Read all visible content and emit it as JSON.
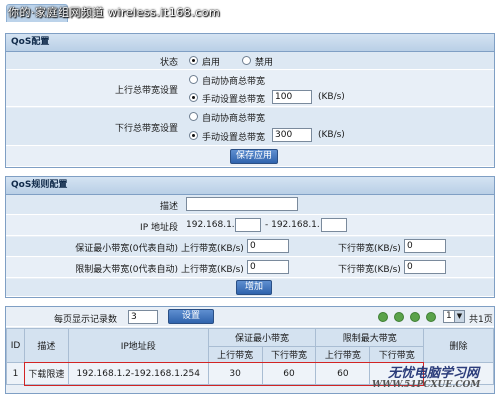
{
  "header": {
    "watermark": "你的·家庭组网频道 wireless.it168.com"
  },
  "qos_config": {
    "title": "QoS配置",
    "status": {
      "label": "状态",
      "options": [
        "启用",
        "禁用"
      ],
      "selected": "启用"
    },
    "upload": {
      "label": "上行总带宽设置",
      "auto_option": "自动协商总带宽",
      "manual_option": "手动设置总带宽",
      "selected": "手动设置总带宽",
      "value": "100",
      "unit": "(KB/s)"
    },
    "download": {
      "label": "下行总带宽设置",
      "auto_option": "自动协商总带宽",
      "manual_option": "手动设置总带宽",
      "selected": "手动设置总带宽",
      "value": "300",
      "unit": "(KB/s)"
    },
    "save_button": "保存应用"
  },
  "qos_rules": {
    "title": "QoS规则配置",
    "description_label": "描述",
    "description_value": "",
    "ip_label": "IP 地址段",
    "ip_prefix_start": "192.168.1.",
    "ip_separator": "- 192.168.1.",
    "ip_start_value": "",
    "ip_end_value": "",
    "min_bw_label": "保证最小带宽(0代表自动)",
    "max_bw_label": "限制最大带宽(0代表自动)",
    "up_kb_label": "上行带宽(KB/s)",
    "down_kb_label": "下行带宽(KB/s)",
    "min_up_value": "0",
    "min_down_value": "0",
    "max_up_value": "0",
    "max_down_value": "0",
    "add_button": "增加"
  },
  "list": {
    "per_page_label": "每页显示记录数",
    "per_page_value": "3",
    "set_button": "设置",
    "page_select": "1",
    "total_pages": "共1页",
    "columns": {
      "id": "ID",
      "desc": "描述",
      "ip": "IP地址段",
      "min_group": "保证最小带宽",
      "max_group": "限制最大带宽",
      "up": "上行带宽",
      "down": "下行带宽",
      "delete": "删除"
    },
    "rows": [
      {
        "id": "1",
        "desc": "下载限速",
        "ip": "192.168.1.2-192.168.1.254",
        "min_up": "30",
        "min_down": "60",
        "max_up": "60",
        "max_down": ""
      }
    ]
  },
  "footer_watermark": {
    "line1": "无忧电脑学习网",
    "line2": "WWW.51PCXUE.COM"
  },
  "colors": {
    "accent": "#2f63ad",
    "panel_border": "#7f9fc4",
    "highlight_box": "#d22424"
  }
}
